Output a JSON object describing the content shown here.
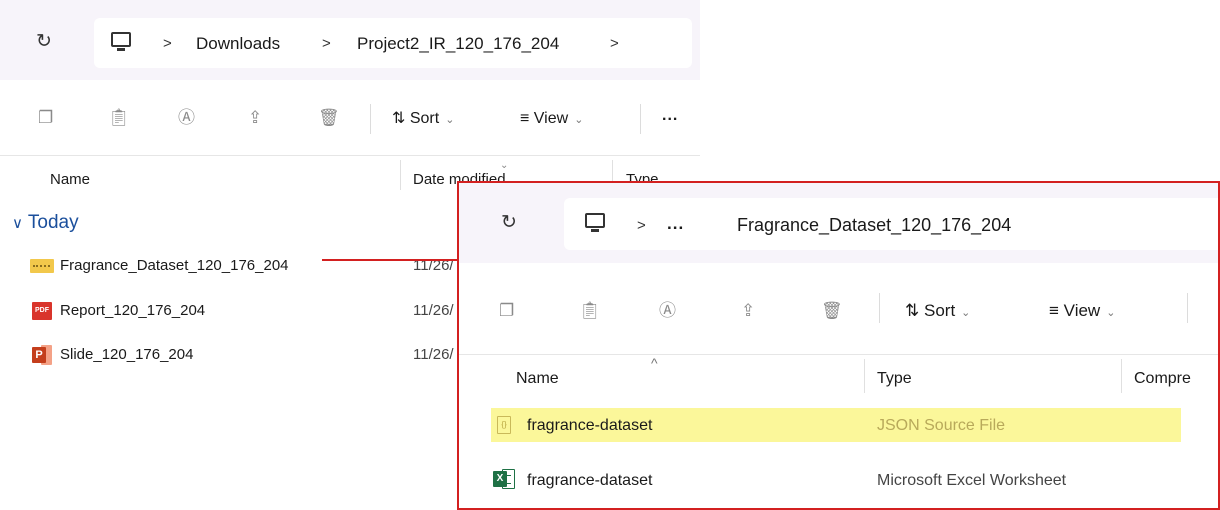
{
  "explorer_main": {
    "breadcrumb": [
      "Downloads",
      "Project2_IR_120_176_204"
    ],
    "breadcrumb_separator": ">",
    "toolbar": {
      "sort_label": "Sort",
      "view_label": "View",
      "more_label": "..."
    },
    "columns": {
      "name": "Name",
      "date_modified": "Date modified",
      "type": "Type"
    },
    "group_label": "Today",
    "files": [
      {
        "name": "Fragrance_Dataset_120_176_204",
        "date": "11/26/",
        "icon": "zip-folder-icon"
      },
      {
        "name": "Report_120_176_204",
        "date": "11/26/",
        "icon": "pdf-icon"
      },
      {
        "name": "Slide_120_176_204",
        "date": "11/26/",
        "icon": "powerpoint-icon"
      }
    ]
  },
  "explorer_archive": {
    "breadcrumb_ellipsis": "...",
    "breadcrumb_separator": ">",
    "folder_name": "Fragrance_Dataset_120_176_204",
    "toolbar": {
      "sort_label": "Sort",
      "view_label": "View"
    },
    "columns": {
      "name": "Name",
      "type": "Type",
      "compressed": "Compre"
    },
    "files": [
      {
        "name": "fragrance-dataset",
        "type": "JSON Source File",
        "icon": "json-file-icon",
        "highlighted": true
      },
      {
        "name": "fragrance-dataset",
        "type": "Microsoft Excel Worksheet",
        "icon": "excel-icon",
        "highlighted": false
      }
    ]
  },
  "colors": {
    "highlight": "#fbf79a",
    "annotation_red": "#d32020",
    "group_blue": "#1b4f9c",
    "address_bar_bg": "#f7f4fa"
  }
}
